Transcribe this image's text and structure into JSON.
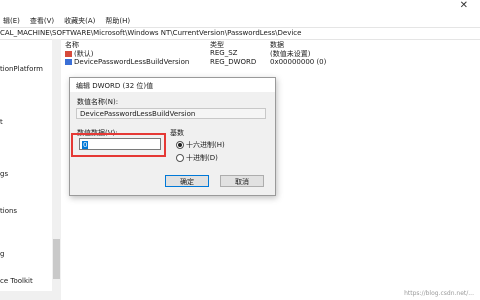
{
  "menu": [
    "辑(E)",
    "查看(V)",
    "收藏夹(A)",
    "帮助(H)"
  ],
  "window": {
    "close_symbol": "✕"
  },
  "address": "CAL_MACHINE\\SOFTWARE\\Microsoft\\Windows NT\\CurrentVersion\\PasswordLess\\Device",
  "tree": [
    "tionPlatform",
    "t",
    "gs",
    "tions",
    "g",
    "ce Toolkit"
  ],
  "list": {
    "headers": [
      "名称",
      "类型",
      "数据"
    ],
    "rows": [
      {
        "name": "(默认)",
        "type": "REG_SZ",
        "data": "(数值未设置)",
        "icon": "string-value-icon"
      },
      {
        "name": "DevicePasswordLessBuildVersion",
        "type": "REG_DWORD",
        "data": "0x00000000 (0)",
        "icon": "dword-value-icon"
      }
    ]
  },
  "dialog": {
    "title": "编辑 DWORD (32 位)值",
    "name_label": "数值名称(N):",
    "name_value": "DevicePasswordLessBuildVersion",
    "data_label": "数值数据(V):",
    "data_value": "0",
    "base_label": "基数",
    "radio_hex": "十六进制(H)",
    "radio_dec": "十进制(D)",
    "hex_selected": true,
    "ok": "确定",
    "cancel": "取消"
  },
  "watermark": "https://blog.csdn.net/...",
  "colors": {
    "highlight": "#e53935",
    "selection": "#0078d7"
  }
}
